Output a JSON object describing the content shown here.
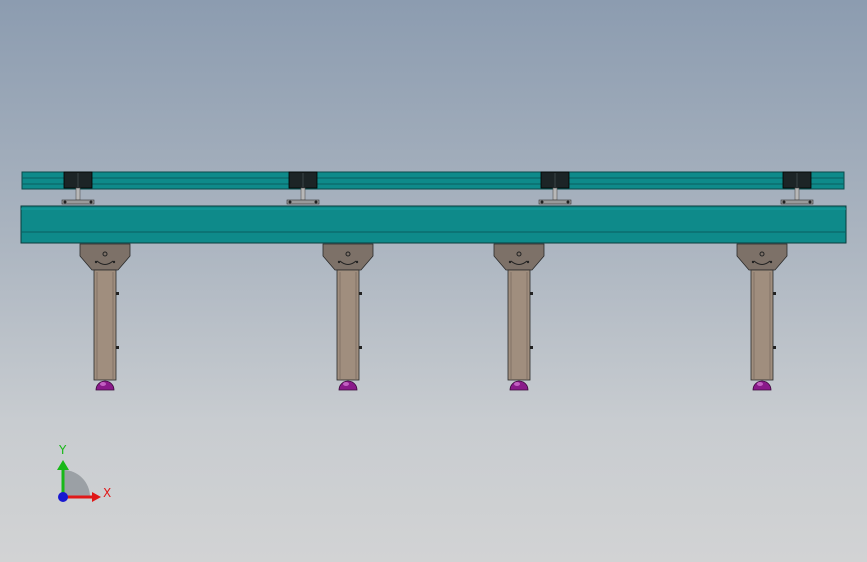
{
  "viewport": {
    "background_top": "#8c9cb0",
    "background_bottom": "#d2d3d4"
  },
  "model": {
    "beam_color": "#0e8a8a",
    "beam_edge_color": "#0a5f60",
    "leg_color": "#a08e7e",
    "bracket_color": "#7d7168",
    "foot_color": "#8a1a8a",
    "clamp_color": "#1c2426",
    "leg_count": 4,
    "clamp_count": 4
  },
  "triad": {
    "x_label": "X",
    "y_label": "Y",
    "x_color": "#e01818",
    "y_color": "#18b818",
    "z_color": "#1818d0"
  }
}
